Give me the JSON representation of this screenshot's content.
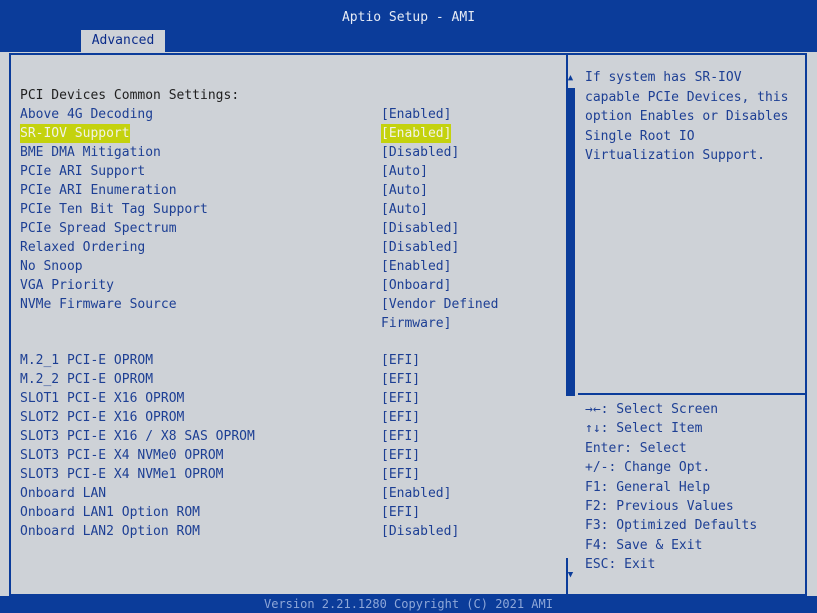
{
  "app_title": "Aptio Setup - AMI",
  "active_tab": "Advanced",
  "settings": [
    {
      "label": "PCI Devices Common Settings:",
      "value": ""
    },
    {
      "label": "Above 4G Decoding",
      "value": "[Enabled]"
    },
    {
      "label": "SR-IOV Support",
      "value": "[Enabled]",
      "selected": true
    },
    {
      "label": "BME DMA Mitigation",
      "value": "[Disabled]"
    },
    {
      "label": "PCIe ARI Support",
      "value": "[Auto]"
    },
    {
      "label": "PCIe ARI Enumeration",
      "value": "[Auto]"
    },
    {
      "label": "PCIe Ten Bit Tag Support",
      "value": "[Auto]"
    },
    {
      "label": "PCIe Spread Spectrum",
      "value": "[Disabled]"
    },
    {
      "label": "Relaxed Ordering",
      "value": "[Disabled]"
    },
    {
      "label": "No Snoop",
      "value": "[Enabled]"
    },
    {
      "label": "VGA Priority",
      "value": "[Onboard]"
    },
    {
      "label": "NVMe Firmware Source",
      "value": "[Vendor Defined",
      "value_line2": "Firmware]"
    },
    {
      "label": "M.2_1 PCI-E OPROM",
      "value": "[EFI]"
    },
    {
      "label": "M.2_2 PCI-E OPROM",
      "value": "[EFI]"
    },
    {
      "label": "SLOT1 PCI-E X16 OPROM",
      "value": "[EFI]"
    },
    {
      "label": "SLOT2 PCI-E X16 OPROM",
      "value": "[EFI]"
    },
    {
      "label": "SLOT3 PCI-E X16 / X8 SAS OPROM",
      "value": "[EFI]"
    },
    {
      "label": "SLOT3 PCI-E X4 NVMe0 OPROM",
      "value": "[EFI]"
    },
    {
      "label": "SLOT3 PCI-E X4 NVMe1 OPROM",
      "value": "[EFI]"
    },
    {
      "label": "Onboard LAN",
      "value": "[Enabled]"
    },
    {
      "label": "Onboard LAN1 Option ROM",
      "value": "[EFI]"
    },
    {
      "label": "Onboard LAN2 Option ROM",
      "value": "[Disabled]"
    }
  ],
  "help_text": [
    "If system has SR-IOV",
    "capable PCIe Devices, this",
    "option Enables or Disables",
    "Single Root IO",
    "Virtualization Support."
  ],
  "key_help": [
    "→←: Select Screen",
    "↑↓: Select Item",
    "Enter: Select",
    "+/-: Change Opt.",
    "F1: General Help",
    "F2: Previous Values",
    "F3: Optimized Defaults",
    "F4: Save & Exit",
    "ESC: Exit"
  ],
  "scrollbar": {
    "up_icon": "▲",
    "down_icon": "▼",
    "position_fraction": 0.0
  },
  "footer": "Version 2.21.1280 Copyright (C) 2021 AMI",
  "colors": {
    "header_blue": "#0b3c9a",
    "background": "#ced2d7",
    "text_blue": "#1d3f94",
    "highlight": "#c4d20e"
  }
}
